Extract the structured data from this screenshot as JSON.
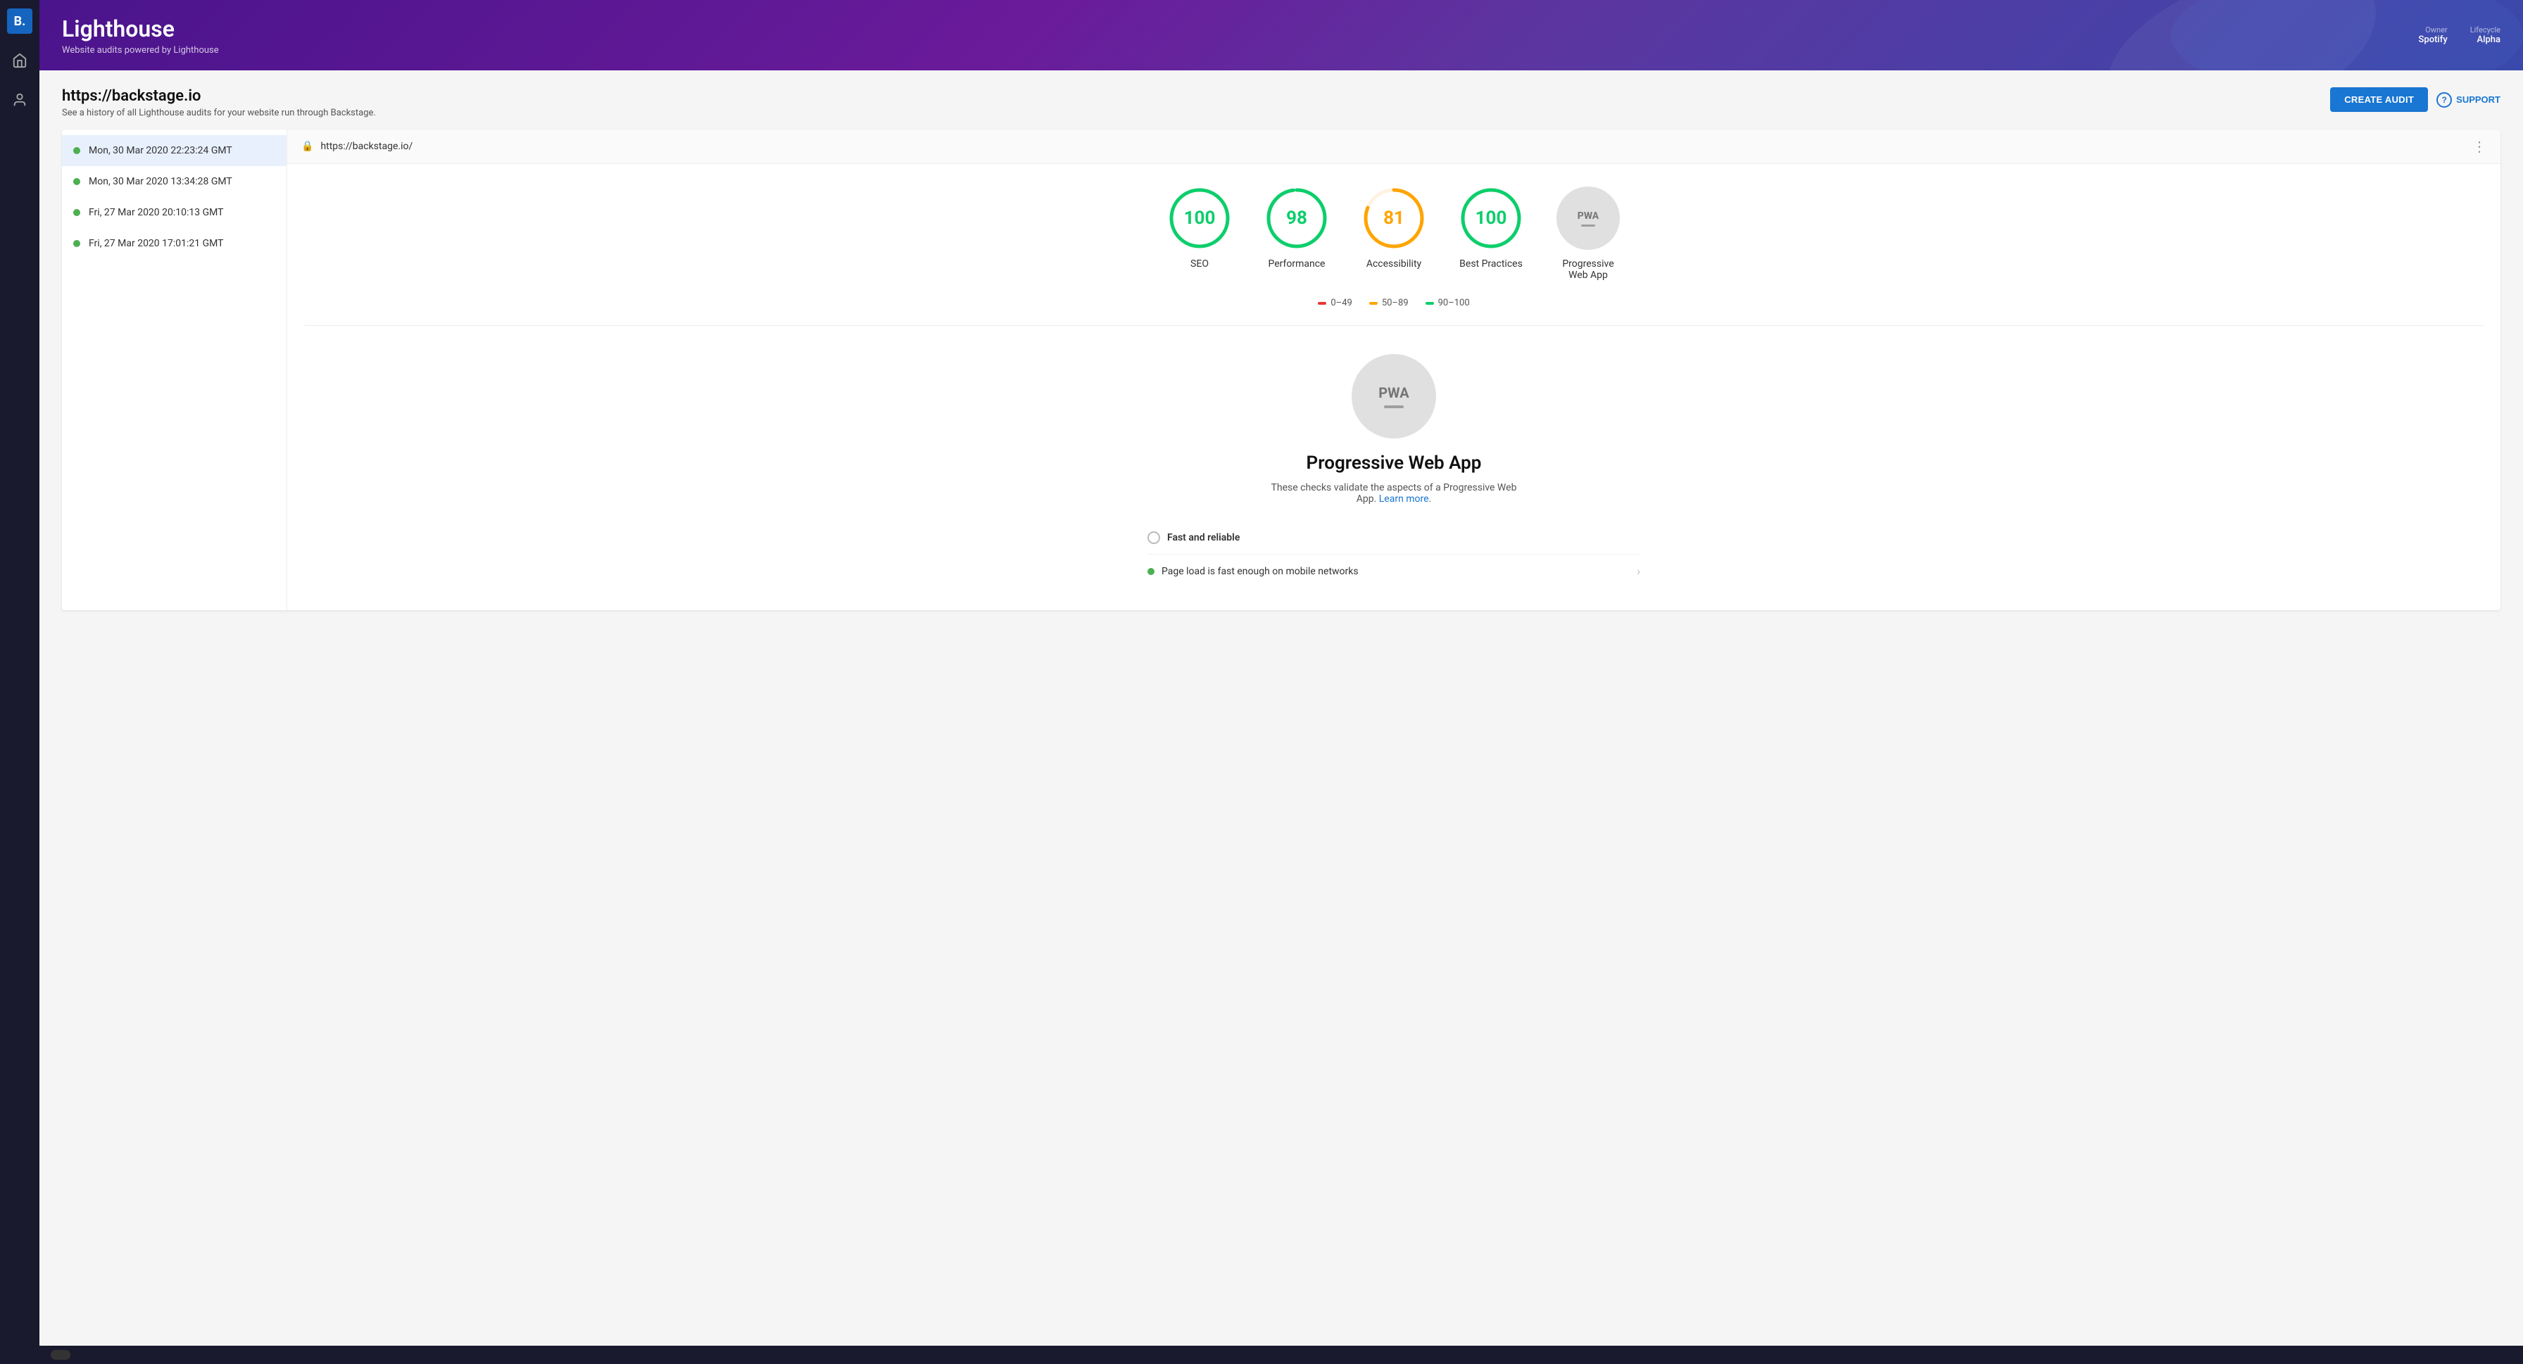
{
  "nav": {
    "logo": "B.",
    "home_icon": "⌂",
    "person_icon": "👤"
  },
  "header": {
    "title": "Lighthouse",
    "subtitle": "Website audits powered by Lighthouse",
    "owner_label": "Owner",
    "owner_value": "Spotify",
    "lifecycle_label": "Lifecycle",
    "lifecycle_value": "Alpha"
  },
  "page": {
    "url": "https://backstage.io",
    "description": "See a history of all Lighthouse audits for your website run through Backstage.",
    "create_audit_label": "CREATE AUDIT",
    "support_label": "SUPPORT"
  },
  "audit_list": [
    {
      "id": 1,
      "timestamp": "Mon, 30 Mar 2020 22:23:24 GMT",
      "status": "green",
      "active": true
    },
    {
      "id": 2,
      "timestamp": "Mon, 30 Mar 2020 13:34:28 GMT",
      "status": "green",
      "active": false
    },
    {
      "id": 3,
      "timestamp": "Fri, 27 Mar 2020 20:10:13 GMT",
      "status": "green",
      "active": false
    },
    {
      "id": 4,
      "timestamp": "Fri, 27 Mar 2020 17:01:21 GMT",
      "status": "green",
      "active": false
    }
  ],
  "audit_detail": {
    "url": "https://backstage.io/",
    "scores": [
      {
        "label": "SEO",
        "value": 100,
        "color": "green",
        "stroke": "#0cce6b",
        "bg": "none"
      },
      {
        "label": "Performance",
        "value": 98,
        "color": "green",
        "stroke": "#0cce6b",
        "bg": "none"
      },
      {
        "label": "Accessibility",
        "value": 81,
        "color": "orange",
        "stroke": "#ffa400",
        "bg": "none"
      },
      {
        "label": "Best Practices",
        "value": 100,
        "color": "green",
        "stroke": "#0cce6b",
        "bg": "none"
      }
    ],
    "pwa_label": "Progressive Web App",
    "legend": [
      {
        "range": "0–49",
        "color": "red"
      },
      {
        "range": "50–89",
        "color": "orange"
      },
      {
        "range": "90–100",
        "color": "green"
      }
    ]
  },
  "pwa_detail": {
    "title": "Progressive Web App",
    "description": "These checks validate the aspects of a Progressive Web App.",
    "learn_more": "Learn more",
    "section_label": "Fast and reliable",
    "check_item": "Page load is fast enough on mobile networks"
  }
}
